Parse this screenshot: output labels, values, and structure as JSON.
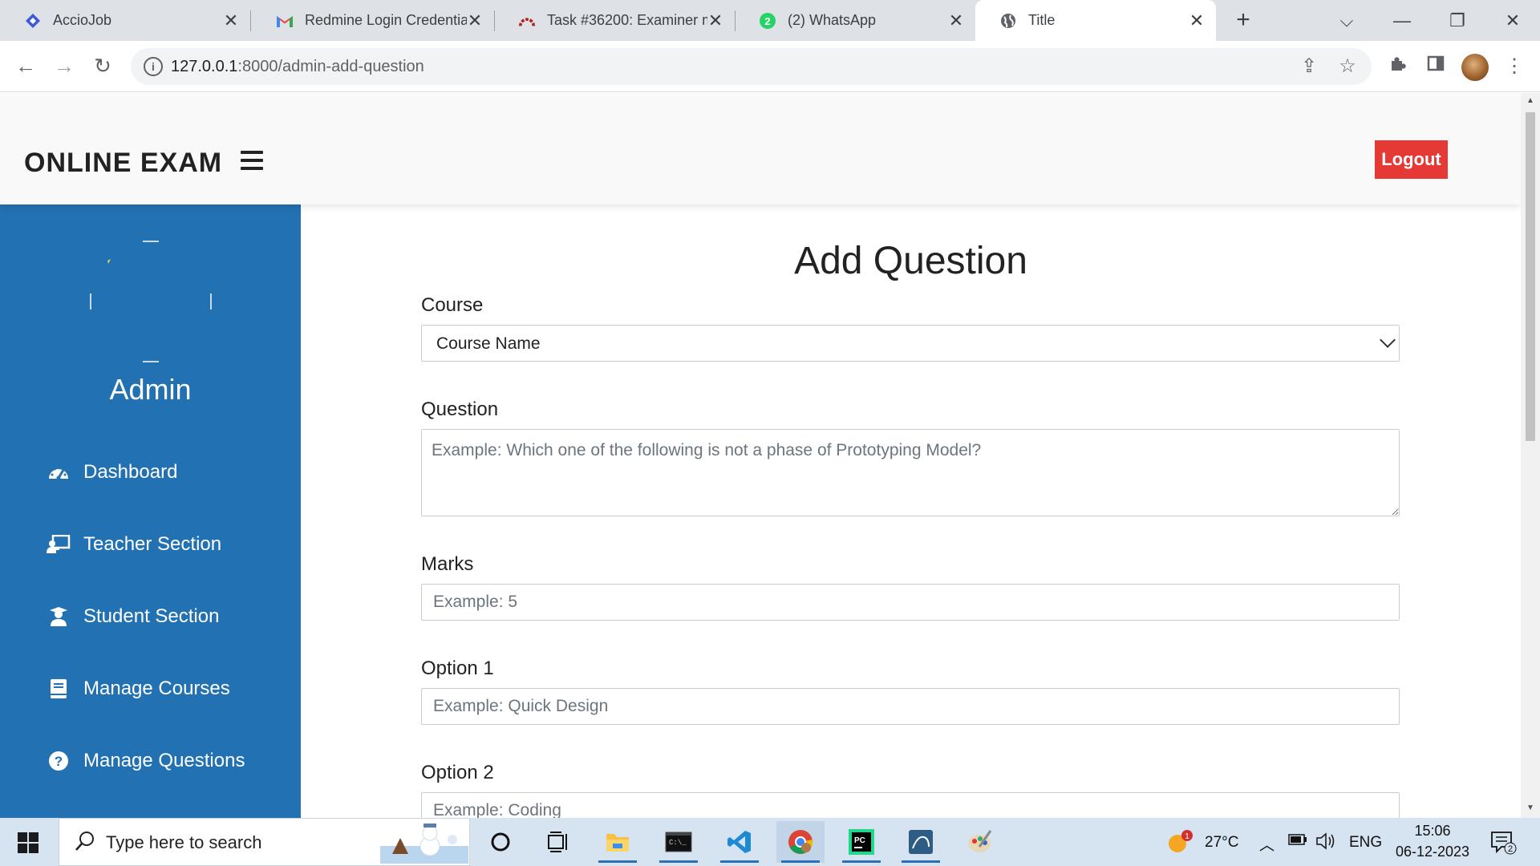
{
  "browser": {
    "tabs": [
      {
        "title": "AccioJob",
        "favicon": "acciojob-icon",
        "active": false
      },
      {
        "title": "Redmine Login Credentia",
        "favicon": "gmail-icon",
        "active": false
      },
      {
        "title": "Task #36200: Examiner m",
        "favicon": "redmine-icon",
        "active": false
      },
      {
        "title": "(2) WhatsApp",
        "favicon": "whatsapp-icon",
        "active": false,
        "badge": "2"
      },
      {
        "title": "Title",
        "favicon": "globe-icon",
        "active": true
      }
    ],
    "url_host": "127.0.0.1",
    "url_rest": ":8000/admin-add-question"
  },
  "header": {
    "brand": "ONLINE EXAM",
    "logout_label": "Logout"
  },
  "sidebar": {
    "role": "Admin",
    "items": [
      {
        "label": "Dashboard",
        "icon": "tachometer-icon"
      },
      {
        "label": "Teacher Section",
        "icon": "chalkboard-teacher-icon"
      },
      {
        "label": "Student Section",
        "icon": "user-graduate-icon"
      },
      {
        "label": "Manage Courses",
        "icon": "book-icon"
      },
      {
        "label": "Manage Questions",
        "icon": "question-circle-icon"
      }
    ]
  },
  "form": {
    "title": "Add Question",
    "course": {
      "label": "Course",
      "selected": "Course Name"
    },
    "question": {
      "label": "Question",
      "placeholder": "Example: Which one of the following is not a phase of Prototyping Model?"
    },
    "marks": {
      "label": "Marks",
      "placeholder": "Example: 5"
    },
    "option1": {
      "label": "Option 1",
      "placeholder": "Example: Quick Design"
    },
    "option2": {
      "label": "Option 2",
      "placeholder": "Example: Coding"
    }
  },
  "taskbar": {
    "search_placeholder": "Type here to search",
    "weather": "27°C",
    "weather_badge": "1",
    "language": "ENG",
    "time": "15:06",
    "date": "06-12-2023",
    "notification_count": "2",
    "apps": [
      "cortana-icon",
      "task-view-icon",
      "file-explorer-icon",
      "terminal-icon",
      "vscode-icon",
      "chrome-icon",
      "pycharm-icon",
      "mysql-workbench-icon",
      "paint-icon"
    ]
  },
  "colors": {
    "sidebar": "#2271b3",
    "logout": "#e53935",
    "header": "#f9f9f9"
  }
}
